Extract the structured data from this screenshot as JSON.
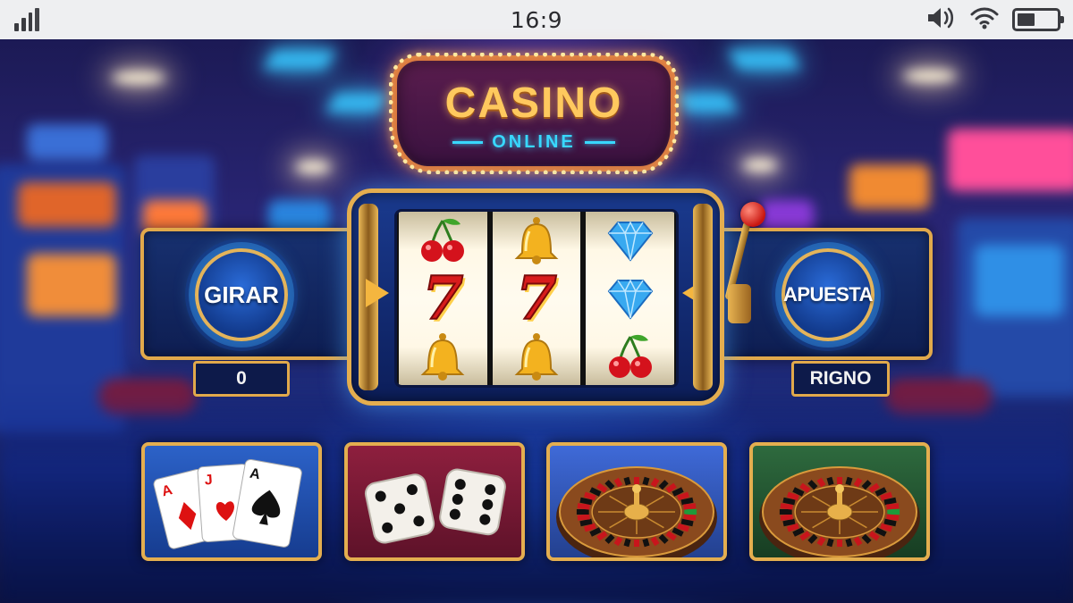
{
  "status_bar": {
    "time": "16:9",
    "icons": [
      "signal-icon",
      "volume-icon",
      "wifi-icon",
      "battery-icon"
    ],
    "battery_level": 0.45
  },
  "sign": {
    "title": "CASINO",
    "subtitle": "ONLINE"
  },
  "controls": {
    "spin_label": "GIRAR",
    "bet_label": "APUESTA",
    "left_counter": "0",
    "right_counter": "RIGNO"
  },
  "reels": [
    [
      "cherry",
      "seven",
      "bell"
    ],
    [
      "bell",
      "seven",
      "bell"
    ],
    [
      "diamond",
      "diamond",
      "cherry"
    ]
  ],
  "games": [
    {
      "name": "cards",
      "icon": "playing-cards-icon",
      "cards": [
        "A",
        "J",
        "A"
      ]
    },
    {
      "name": "dice",
      "icon": "dice-icon"
    },
    {
      "name": "roulette",
      "icon": "roulette-wheel-icon"
    },
    {
      "name": "roulette",
      "icon": "roulette-wheel-icon"
    }
  ],
  "colors": {
    "gold_frame": "#e4ae4f",
    "button_blue": "#2a6bd8",
    "sign_text": "#ffc95e",
    "sign_subtext": "#38d8ff",
    "seven_red": "#d81c1c"
  }
}
